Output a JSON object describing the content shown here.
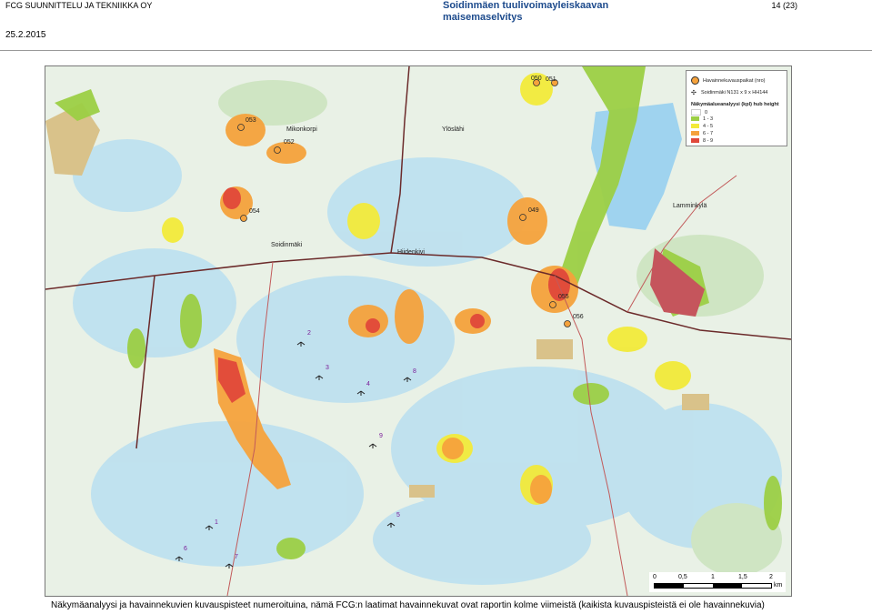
{
  "header": {
    "company": "FCG SUUNNITTELU JA TEKNIIKKA OY",
    "title_line1": "Soidinmäen tuulivoimayleiskaavan",
    "title_line2": "maisemaselvitys",
    "page": "14 (23)",
    "date": "25.2.2015"
  },
  "legend": {
    "viewpoints_label": "Havainnekuvauspaikat (nro)",
    "turbines_label": "Soidinmäki N131 x 9 x HH144",
    "visibility_title": "Näkymäalueanalyysi (kpl) hub height",
    "classes": [
      {
        "label": "0",
        "color": "#ffffff"
      },
      {
        "label": "1 - 3",
        "color": "#9ccf45"
      },
      {
        "label": "4 - 5",
        "color": "#f2ea3a"
      },
      {
        "label": "6 - 7",
        "color": "#f5a23c"
      },
      {
        "label": "8 - 9",
        "color": "#e0483a"
      }
    ]
  },
  "viewpoints": [
    "050",
    "051",
    "053",
    "052",
    "054",
    "049",
    "055",
    "056"
  ],
  "turbines": [
    "1",
    "2",
    "3",
    "4",
    "5",
    "6",
    "7",
    "8",
    "9"
  ],
  "place_names": [
    "Mikonkorpi",
    "Ylöslähi",
    "Soidinmäki",
    "Hiidenkivi",
    "Lamminkylä"
  ],
  "scalebar": {
    "ticks": [
      "0",
      "0,5",
      "1",
      "1,5",
      "2"
    ],
    "unit": "km"
  },
  "caption": "Näkymäanalyysi ja havainnekuvien kuvauspisteet numeroituina, nämä FCG:n laatimat havainnekuvat ovat raportin kolme viimeistä (kaikista kuvauspisteistä ei ole havainnekuvia)"
}
